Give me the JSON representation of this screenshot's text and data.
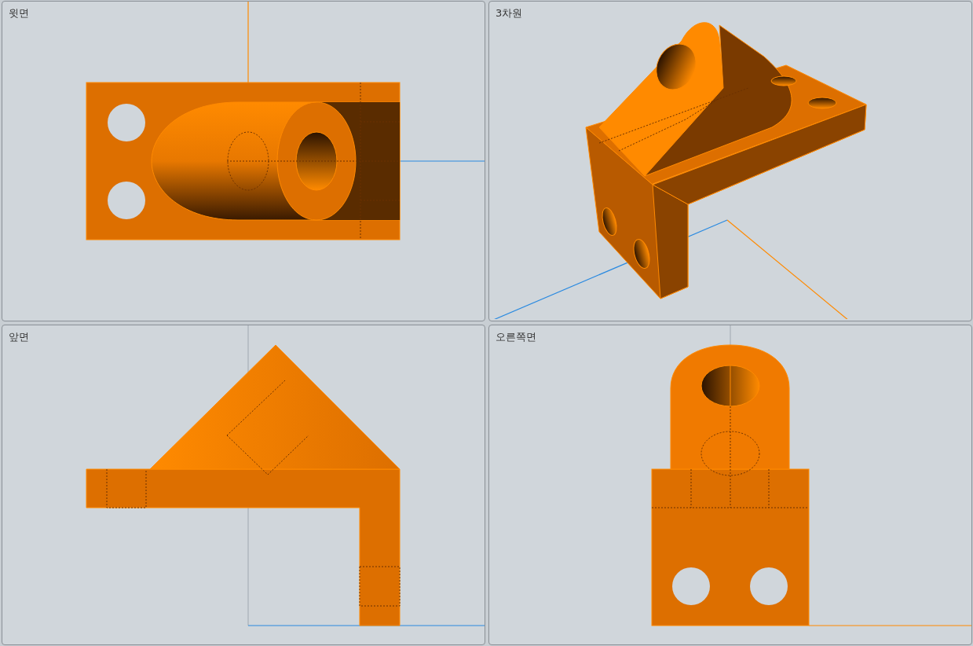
{
  "viewports": [
    {
      "label": "윗면",
      "kind": "top"
    },
    {
      "label": "3차원",
      "kind": "iso"
    },
    {
      "label": "앞면",
      "kind": "front"
    },
    {
      "label": "오른쪽면",
      "kind": "right"
    }
  ]
}
